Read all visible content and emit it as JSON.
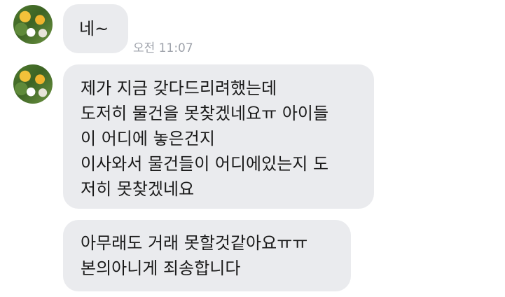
{
  "messages": [
    {
      "lines": [
        "네~"
      ],
      "time": "오전 11:07"
    },
    {
      "lines": [
        "제가 지금 갖다드리려했는데",
        "도저히 물건을 못찾겠네요ㅠ 아이들",
        "이 어디에 놓은건지",
        "이사와서 물건들이 어디에있는지 도",
        "저히 못찾겠네요"
      ]
    },
    {
      "lines": [
        "아무래도 거래 못할것같아요ㅠㅠ",
        "본의아니게 죄송합니다"
      ]
    }
  ],
  "colors": {
    "bubble": "#eaebee",
    "text": "#1a1a1a",
    "time": "#9fa3ab",
    "background": "#ffffff"
  }
}
